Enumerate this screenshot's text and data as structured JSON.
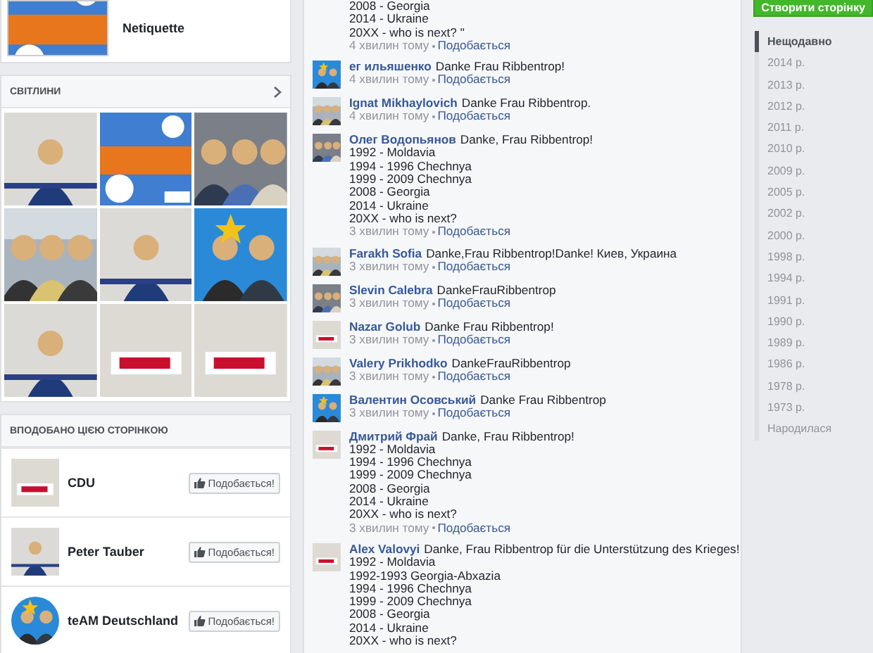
{
  "netiquette_card": {
    "title": "Netiquette"
  },
  "photos": {
    "title": "СВІТЛИНИ"
  },
  "liked_pages": {
    "title": "ВПОДОБАНО ЦІЄЮ СТОРІНКОЮ",
    "pages": [
      {
        "name": "CDU",
        "button": "Подобається!"
      },
      {
        "name": "Peter Tauber",
        "button": "Подобається!"
      },
      {
        "name": "teAM Deutschland",
        "button": "Подобається!"
      }
    ]
  },
  "comments": [
    {
      "lines": [
        "2008 - Georgia",
        "2014 - Ukraine",
        "20XX - who is next? \""
      ],
      "time": "4 хвилин тому",
      "like": "Подобається"
    },
    {
      "author": "ег ильяшенко",
      "text": "Danke Frau Ribbentrop!",
      "time": "4 хвилин тому",
      "like": "Подобається"
    },
    {
      "author": "Ignat Mikhaylovich",
      "text": "Danke Frau Ribbentrop.",
      "time": "4 хвилин тому",
      "like": "Подобається"
    },
    {
      "author": "Олег Водопьянов",
      "text": "Danke, Frau Ribbentrop!",
      "lines": [
        "1992 - Moldavia",
        "1994 - 1996 Chechnya",
        "1999 - 2009 Chechnya",
        "2008 - Georgia",
        "2014 - Ukraine",
        "20XX - who is next?"
      ],
      "time": "3 хвилин тому",
      "like": "Подобається"
    },
    {
      "author": "Farakh Sofia",
      "text": "Danke,Frau Ribbentrop!Danke! Киев, Украина",
      "time": "3 хвилин тому",
      "like": "Подобається"
    },
    {
      "author": "Slevin Calebra",
      "text": "DankeFrauRibbentrop",
      "time": "3 хвилин тому",
      "like": "Подобається"
    },
    {
      "author": "Nazar Golub",
      "text": "Danke Frau Ribbentrop!",
      "time": "3 хвилин тому",
      "like": "Подобається"
    },
    {
      "author": "Valery Prikhodko",
      "text": "DankeFrauRibbentrop",
      "time": "3 хвилин тому",
      "like": "Подобається"
    },
    {
      "author": "Валентин Осовський",
      "text": "Danke Frau Ribbentrop",
      "time": "3 хвилин тому",
      "like": "Подобається"
    },
    {
      "author": "Дмитрий Фрай",
      "text": "Danke, Frau Ribbentrop!",
      "lines": [
        "1992 - Moldavia",
        "1994 - 1996 Chechnya",
        "1999 - 2009 Chechnya",
        "2008 - Georgia",
        "2014 - Ukraine",
        "20XX - who is next?"
      ],
      "time": "3 хвилин тому",
      "like": "Подобається"
    },
    {
      "author": "Alex Valovyi",
      "text": "Danke, Frau Ribbentrop für die Unterstützung des Krieges!",
      "lines": [
        "1992 - Moldavia",
        "1992-1993 Georgia-Abxazia",
        "1994 - 1996 Chechnya",
        "1999 - 2009 Chechnya",
        "2008 - Georgia",
        "2014 - Ukraine",
        "20XX - who is next?"
      ]
    }
  ],
  "timeline": {
    "button": "Створити сторінку",
    "items": [
      {
        "label": "Нещодавно",
        "selected": true
      },
      {
        "label": "2014 р.",
        "selected": false
      },
      {
        "label": "2013 р.",
        "selected": false
      },
      {
        "label": "2012 р.",
        "selected": false
      },
      {
        "label": "2011 р.",
        "selected": false
      },
      {
        "label": "2010 р.",
        "selected": false
      },
      {
        "label": "2009 р.",
        "selected": false
      },
      {
        "label": "2005 р.",
        "selected": false
      },
      {
        "label": "2002 р.",
        "selected": false
      },
      {
        "label": "2000 р.",
        "selected": false
      },
      {
        "label": "1998 р.",
        "selected": false
      },
      {
        "label": "1994 р.",
        "selected": false
      },
      {
        "label": "1991 р.",
        "selected": false
      },
      {
        "label": "1990 р.",
        "selected": false
      },
      {
        "label": "1989 р.",
        "selected": false
      },
      {
        "label": "1986 р.",
        "selected": false
      },
      {
        "label": "1978 р.",
        "selected": false
      },
      {
        "label": "1973 р.",
        "selected": false
      },
      {
        "label": "Народилася",
        "selected": false
      }
    ]
  }
}
